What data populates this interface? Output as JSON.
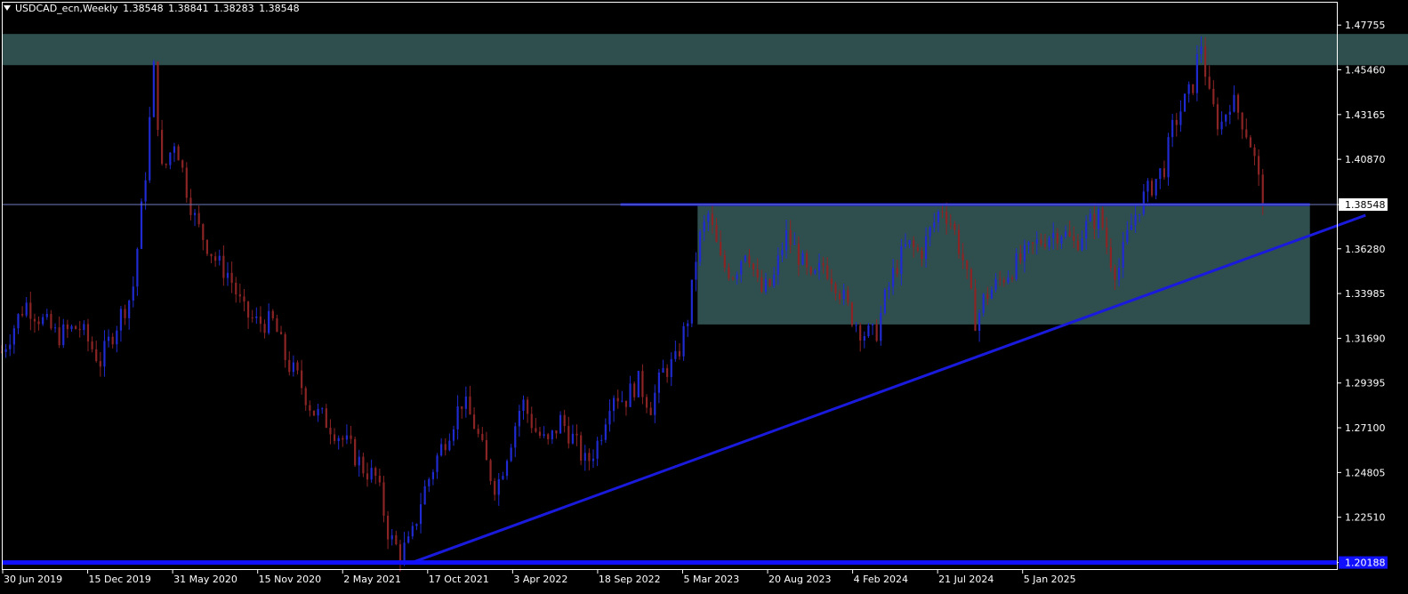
{
  "header": {
    "symbol": "USDCAD_ecn,Weekly",
    "open": "1.38548",
    "high": "1.38841",
    "low": "1.38283",
    "close": "1.38548"
  },
  "chart_data": {
    "type": "candlestick",
    "y_axis": {
      "ticks": [
        "1.47755",
        "1.45460",
        "1.43165",
        "1.40870",
        "1.38548",
        "1.36280",
        "1.33985",
        "1.31690",
        "1.29395",
        "1.27100",
        "1.24805",
        "1.22510",
        "1.20188"
      ],
      "range": [
        1.1985,
        1.4895
      ],
      "current_price_label": "1.38548",
      "support_label": "1.20188"
    },
    "x_axis": {
      "ticks": [
        "30 Jun 2019",
        "15 Dec 2019",
        "31 May 2020",
        "15 Nov 2020",
        "2 May 2021",
        "17 Oct 2021",
        "3 Apr 2022",
        "18 Sep 2022",
        "5 Mar 2023",
        "20 Aug 2023",
        "4 Feb 2024",
        "21 Jul 2024",
        "5 Jan 2025"
      ]
    },
    "series_path": [
      [
        2019.49,
        1.31
      ],
      [
        2019.6,
        1.335
      ],
      [
        2019.75,
        1.318
      ],
      [
        2019.85,
        1.323
      ],
      [
        2019.95,
        1.305
      ],
      [
        2020.05,
        1.33
      ],
      [
        2020.1,
        1.34
      ],
      [
        2020.16,
        1.4
      ],
      [
        2020.2,
        1.455
      ],
      [
        2020.24,
        1.4
      ],
      [
        2020.3,
        1.42
      ],
      [
        2020.35,
        1.395
      ],
      [
        2020.4,
        1.375
      ],
      [
        2020.45,
        1.365
      ],
      [
        2020.5,
        1.355
      ],
      [
        2020.55,
        1.35
      ],
      [
        2020.62,
        1.33
      ],
      [
        2020.68,
        1.325
      ],
      [
        2020.76,
        1.325
      ],
      [
        2020.82,
        1.305
      ],
      [
        2020.88,
        1.295
      ],
      [
        2020.94,
        1.28
      ],
      [
        2021.0,
        1.275
      ],
      [
        2021.06,
        1.268
      ],
      [
        2021.12,
        1.26
      ],
      [
        2021.18,
        1.25
      ],
      [
        2021.24,
        1.245
      ],
      [
        2021.3,
        1.215
      ],
      [
        2021.35,
        1.207
      ],
      [
        2021.4,
        1.212
      ],
      [
        2021.45,
        1.235
      ],
      [
        2021.52,
        1.255
      ],
      [
        2021.58,
        1.27
      ],
      [
        2021.64,
        1.285
      ],
      [
        2021.7,
        1.272
      ],
      [
        2021.76,
        1.25
      ],
      [
        2021.8,
        1.24
      ],
      [
        2021.86,
        1.262
      ],
      [
        2021.92,
        1.285
      ],
      [
        2021.98,
        1.27
      ],
      [
        2022.04,
        1.262
      ],
      [
        2022.1,
        1.275
      ],
      [
        2022.16,
        1.265
      ],
      [
        2022.22,
        1.252
      ],
      [
        2022.28,
        1.265
      ],
      [
        2022.34,
        1.29
      ],
      [
        2022.4,
        1.285
      ],
      [
        2022.46,
        1.295
      ],
      [
        2022.52,
        1.282
      ],
      [
        2022.58,
        1.3
      ],
      [
        2022.64,
        1.305
      ],
      [
        2022.7,
        1.33
      ],
      [
        2022.74,
        1.365
      ],
      [
        2022.79,
        1.38
      ],
      [
        2022.85,
        1.355
      ],
      [
        2022.91,
        1.35
      ],
      [
        2022.97,
        1.365
      ],
      [
        2023.03,
        1.34
      ],
      [
        2023.09,
        1.345
      ],
      [
        2023.15,
        1.37
      ],
      [
        2023.21,
        1.36
      ],
      [
        2023.27,
        1.345
      ],
      [
        2023.33,
        1.355
      ],
      [
        2023.39,
        1.345
      ],
      [
        2023.45,
        1.33
      ],
      [
        2023.51,
        1.32
      ],
      [
        2023.57,
        1.318
      ],
      [
        2023.61,
        1.335
      ],
      [
        2023.66,
        1.352
      ],
      [
        2023.72,
        1.365
      ],
      [
        2023.78,
        1.36
      ],
      [
        2023.84,
        1.375
      ],
      [
        2023.88,
        1.385
      ],
      [
        2023.93,
        1.375
      ],
      [
        2023.98,
        1.357
      ],
      [
        2024.04,
        1.325
      ],
      [
        2024.08,
        1.338
      ],
      [
        2024.14,
        1.345
      ],
      [
        2024.2,
        1.352
      ],
      [
        2024.26,
        1.358
      ],
      [
        2024.32,
        1.365
      ],
      [
        2024.38,
        1.37
      ],
      [
        2024.44,
        1.372
      ],
      [
        2024.5,
        1.365
      ],
      [
        2024.56,
        1.375
      ],
      [
        2024.62,
        1.38
      ],
      [
        2024.66,
        1.36
      ],
      [
        2024.7,
        1.35
      ],
      [
        2024.75,
        1.37
      ],
      [
        2024.8,
        1.385
      ],
      [
        2024.86,
        1.395
      ],
      [
        2024.92,
        1.405
      ],
      [
        2024.96,
        1.425
      ],
      [
        2025.0,
        1.435
      ],
      [
        2025.05,
        1.445
      ],
      [
        2025.09,
        1.47
      ],
      [
        2025.13,
        1.44
      ],
      [
        2025.18,
        1.425
      ],
      [
        2025.23,
        1.44
      ],
      [
        2025.28,
        1.43
      ],
      [
        2025.33,
        1.415
      ],
      [
        2025.38,
        1.386
      ]
    ],
    "zones": [
      {
        "name": "resistance",
        "x_start": 2019.49,
        "x_end": 2026.4,
        "y_low": 1.457,
        "y_high": 1.473,
        "color": "#2f4f4f"
      },
      {
        "name": "range",
        "x_start": 2022.74,
        "x_end": 2025.6,
        "y_low": 1.324,
        "y_high": 1.386,
        "color": "#2f4f4f"
      }
    ],
    "trendline": [
      [
        2021.4,
        1.2016
      ],
      [
        2025.86,
        1.38
      ]
    ],
    "range_top_line": [
      [
        2022.38,
        1.38548
      ],
      [
        2025.6,
        1.38548
      ]
    ],
    "current_price": 1.38548,
    "support": 1.20188,
    "colors": {
      "background": "#000000",
      "bull": "#1f2bd0",
      "bear": "#8b2424",
      "zone": "#2f4f4f",
      "trendline": "#1a1adc",
      "support_line": "#1010ff",
      "price_line": "#6f7bc0",
      "axis": "#ffffff"
    }
  }
}
